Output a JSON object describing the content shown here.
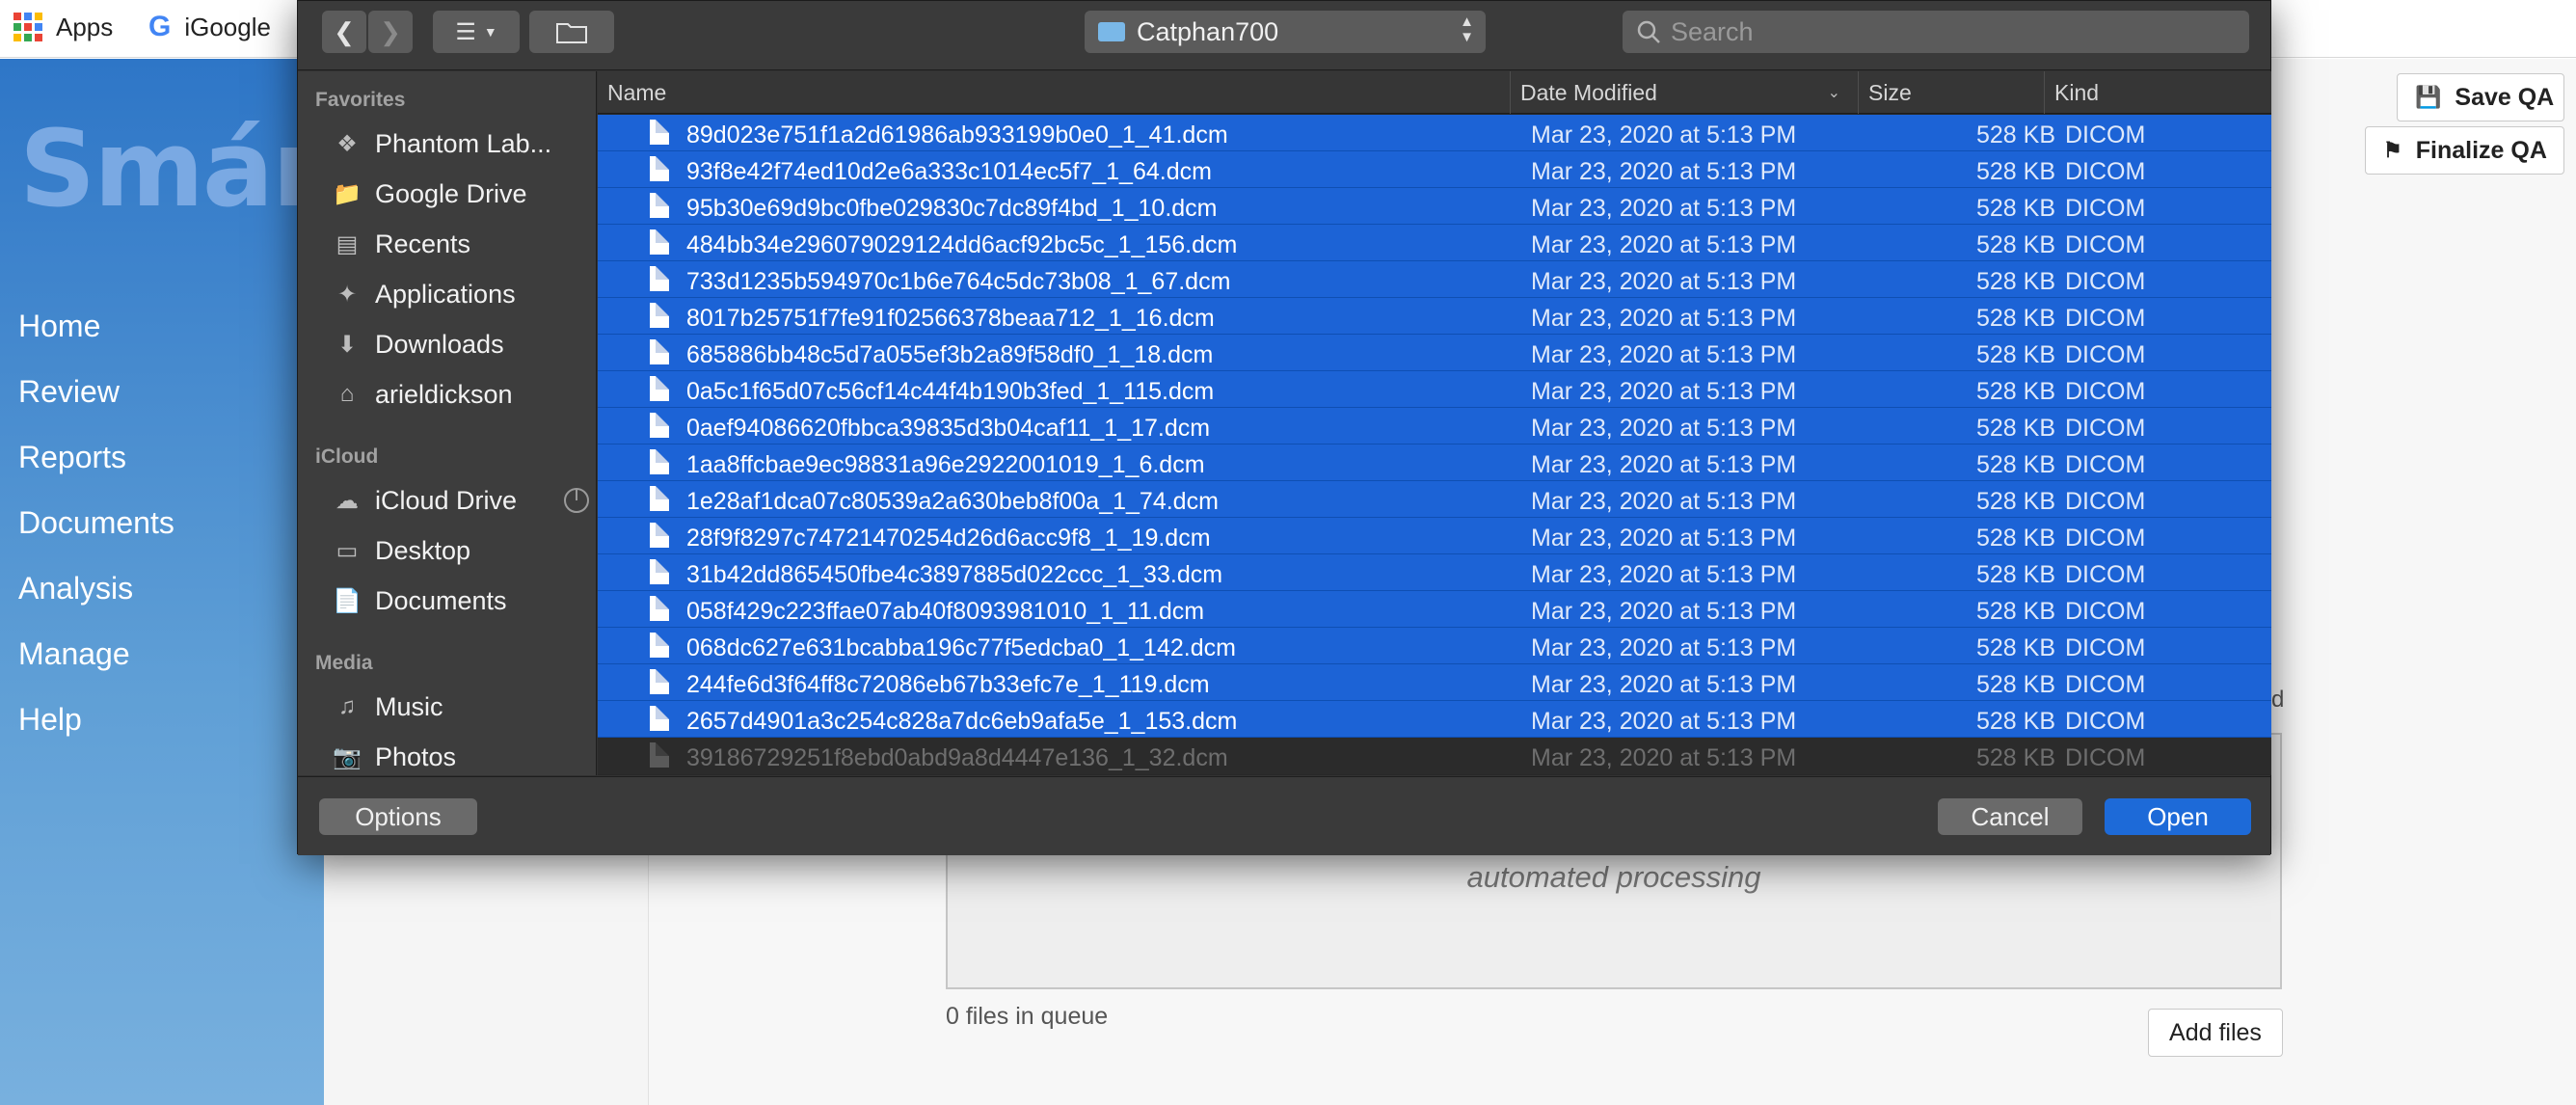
{
  "bookmarks": {
    "apps_label": "Apps",
    "igoogle_label": "iGoogle"
  },
  "app": {
    "logo_text": "Smári",
    "nav": [
      "Home",
      "Review",
      "Reports",
      "Documents",
      "Analysis",
      "Manage",
      "Help"
    ],
    "save_qa_label": "Save QA",
    "finalize_qa_label": "Finalize QA",
    "dropzone_text": "automated processing",
    "queue_text": "0 files in queue",
    "add_files_label": "Add files",
    "side_fragment": "d"
  },
  "dialog": {
    "location": "Catphan700",
    "search_placeholder": "Search",
    "sidebar": {
      "favorites_heading": "Favorites",
      "favorites": [
        {
          "label": "Phantom Lab...",
          "icon": "dropbox-icon"
        },
        {
          "label": "Google Drive",
          "icon": "folder-icon"
        },
        {
          "label": "Recents",
          "icon": "recents-icon"
        },
        {
          "label": "Applications",
          "icon": "applications-icon"
        },
        {
          "label": "Downloads",
          "icon": "downloads-icon"
        },
        {
          "label": "arieldickson",
          "icon": "home-icon"
        }
      ],
      "icloud_heading": "iCloud",
      "icloud": [
        {
          "label": "iCloud Drive",
          "icon": "cloud-icon"
        },
        {
          "label": "Desktop",
          "icon": "desktop-icon"
        },
        {
          "label": "Documents",
          "icon": "documents-icon"
        }
      ],
      "media_heading": "Media",
      "media": [
        {
          "label": "Music",
          "icon": "music-icon"
        },
        {
          "label": "Photos",
          "icon": "camera-icon"
        }
      ]
    },
    "columns": {
      "name": "Name",
      "date": "Date Modified",
      "size": "Size",
      "kind": "Kind"
    },
    "files": [
      {
        "name": "89d023e751f1a2d61986ab933199b0e0_1_41.dcm",
        "date": "Mar 23, 2020 at 5:13 PM",
        "size": "528 KB",
        "kind": "DICOM",
        "selected": true
      },
      {
        "name": "93f8e42f74ed10d2e6a333c1014ec5f7_1_64.dcm",
        "date": "Mar 23, 2020 at 5:13 PM",
        "size": "528 KB",
        "kind": "DICOM",
        "selected": true
      },
      {
        "name": "95b30e69d9bc0fbe029830c7dc89f4bd_1_10.dcm",
        "date": "Mar 23, 2020 at 5:13 PM",
        "size": "528 KB",
        "kind": "DICOM",
        "selected": true
      },
      {
        "name": "484bb34e296079029124dd6acf92bc5c_1_156.dcm",
        "date": "Mar 23, 2020 at 5:13 PM",
        "size": "528 KB",
        "kind": "DICOM",
        "selected": true
      },
      {
        "name": "733d1235b594970c1b6e764c5dc73b08_1_67.dcm",
        "date": "Mar 23, 2020 at 5:13 PM",
        "size": "528 KB",
        "kind": "DICOM",
        "selected": true
      },
      {
        "name": "8017b25751f7fe91f02566378beaa712_1_16.dcm",
        "date": "Mar 23, 2020 at 5:13 PM",
        "size": "528 KB",
        "kind": "DICOM",
        "selected": true
      },
      {
        "name": "685886bb48c5d7a055ef3b2a89f58df0_1_18.dcm",
        "date": "Mar 23, 2020 at 5:13 PM",
        "size": "528 KB",
        "kind": "DICOM",
        "selected": true
      },
      {
        "name": "0a5c1f65d07c56cf14c44f4b190b3fed_1_115.dcm",
        "date": "Mar 23, 2020 at 5:13 PM",
        "size": "528 KB",
        "kind": "DICOM",
        "selected": true
      },
      {
        "name": "0aef94086620fbbca39835d3b04caf11_1_17.dcm",
        "date": "Mar 23, 2020 at 5:13 PM",
        "size": "528 KB",
        "kind": "DICOM",
        "selected": true
      },
      {
        "name": "1aa8ffcbae9ec98831a96e2922001019_1_6.dcm",
        "date": "Mar 23, 2020 at 5:13 PM",
        "size": "528 KB",
        "kind": "DICOM",
        "selected": true
      },
      {
        "name": "1e28af1dca07c80539a2a630beb8f00a_1_74.dcm",
        "date": "Mar 23, 2020 at 5:13 PM",
        "size": "528 KB",
        "kind": "DICOM",
        "selected": true
      },
      {
        "name": "28f9f8297c74721470254d26d6acc9f8_1_19.dcm",
        "date": "Mar 23, 2020 at 5:13 PM",
        "size": "528 KB",
        "kind": "DICOM",
        "selected": true
      },
      {
        "name": "31b42dd865450fbe4c3897885d022ccc_1_33.dcm",
        "date": "Mar 23, 2020 at 5:13 PM",
        "size": "528 KB",
        "kind": "DICOM",
        "selected": true
      },
      {
        "name": "058f429c223ffae07ab40f8093981010_1_11.dcm",
        "date": "Mar 23, 2020 at 5:13 PM",
        "size": "528 KB",
        "kind": "DICOM",
        "selected": true
      },
      {
        "name": "068dc627e631bcabba196c77f5edcba0_1_142.dcm",
        "date": "Mar 23, 2020 at 5:13 PM",
        "size": "528 KB",
        "kind": "DICOM",
        "selected": true
      },
      {
        "name": "244fe6d3f64ff8c72086eb67b33efc7e_1_119.dcm",
        "date": "Mar 23, 2020 at 5:13 PM",
        "size": "528 KB",
        "kind": "DICOM",
        "selected": true
      },
      {
        "name": "2657d4901a3c254c828a7dc6eb9afa5e_1_153.dcm",
        "date": "Mar 23, 2020 at 5:13 PM",
        "size": "528 KB",
        "kind": "DICOM",
        "selected": true
      },
      {
        "name": "39186729251f8ebd0abd9a8d4447e136_1_32.dcm",
        "date": "Mar 23, 2020 at 5:13 PM",
        "size": "528 KB",
        "kind": "DICOM",
        "selected": false
      }
    ],
    "options_label": "Options",
    "cancel_label": "Cancel",
    "open_label": "Open"
  },
  "colors": {
    "selection": "#1c63d6",
    "open_button": "#1d6ad8",
    "sidebar_gradient_top": "#2e76c7"
  }
}
